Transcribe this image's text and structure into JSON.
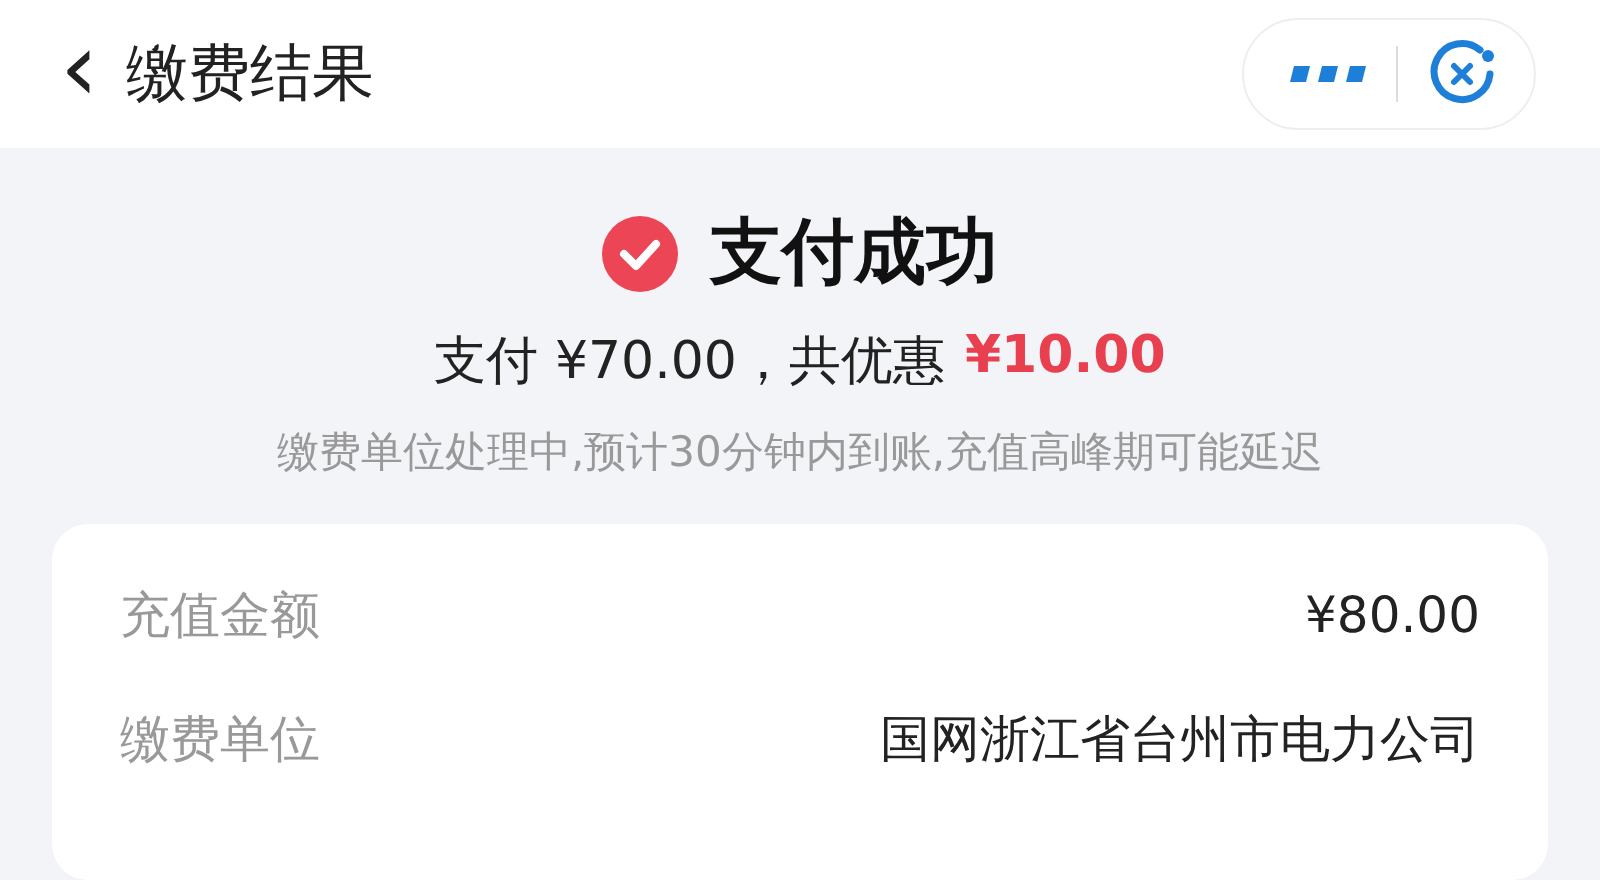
{
  "header": {
    "back_icon": "‹",
    "title": "缴费结果"
  },
  "result": {
    "kind": "success",
    "title": "支付成功",
    "paid_text": "支付 ¥70.00，共优惠",
    "discount": "¥10.00",
    "note": "缴费单位处理中,预计30分钟内到账,充值高峰期可能延迟"
  },
  "details": [
    {
      "label": "充值金额",
      "value": "¥80.00"
    },
    {
      "label": "缴费单位",
      "value": "国网浙江省台州市电力公司"
    }
  ]
}
